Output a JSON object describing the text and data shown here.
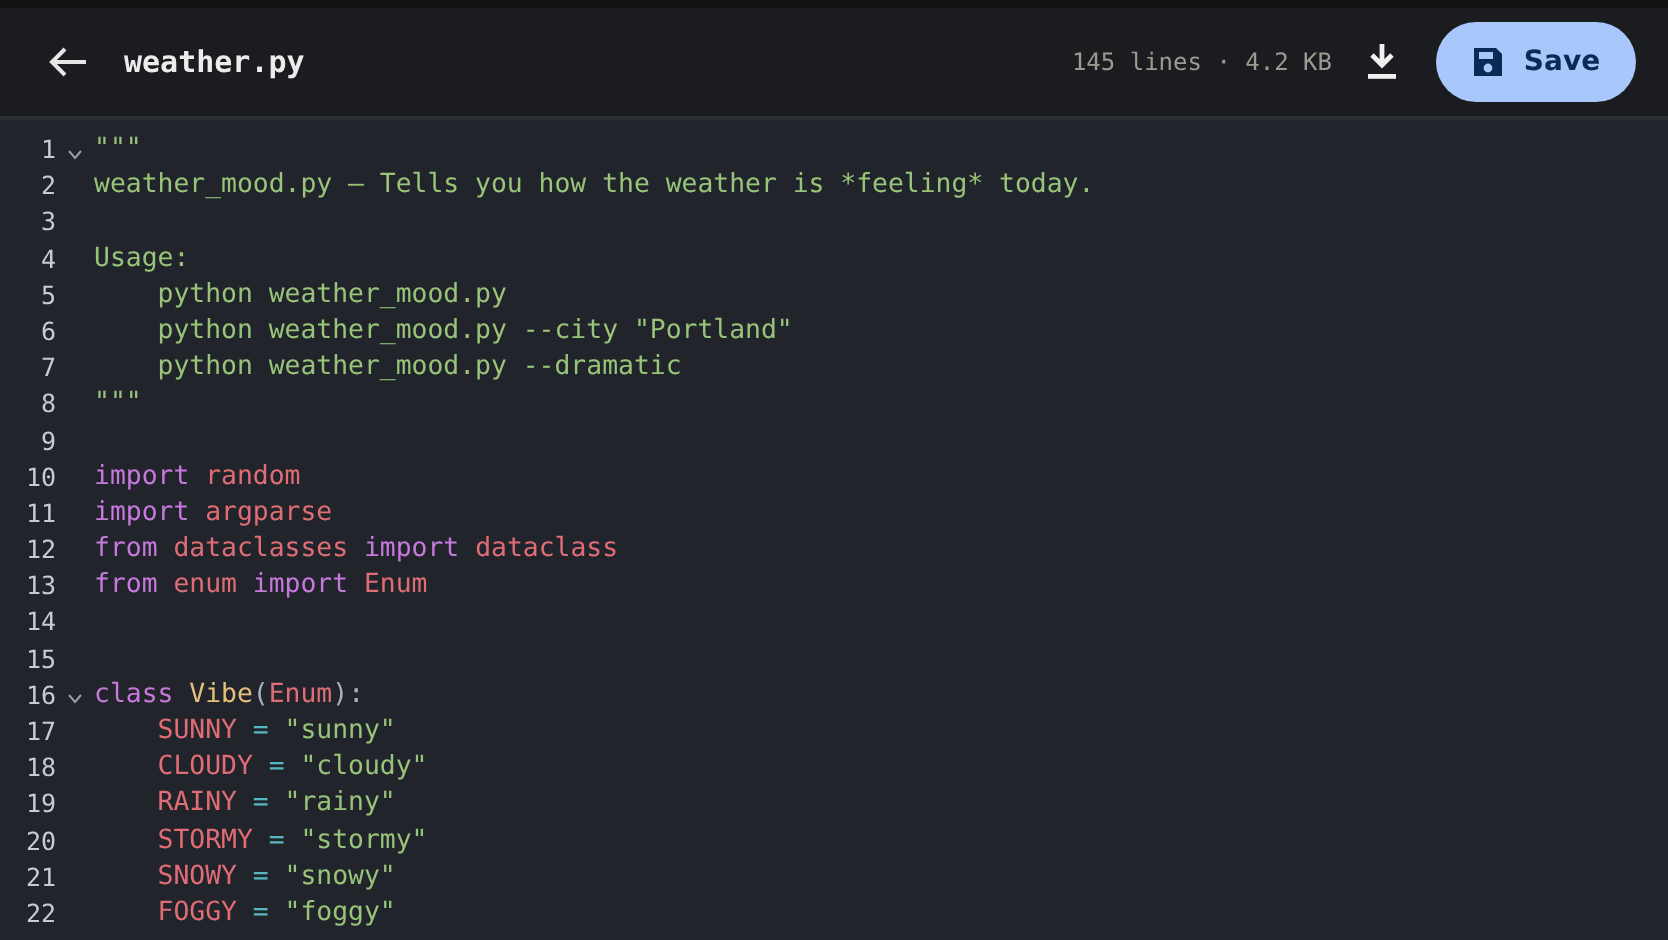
{
  "header": {
    "title": "weather.py",
    "meta": "145 lines · 4.2 KB",
    "save_button": "Save"
  },
  "editor": {
    "lines": [
      {
        "number": "1",
        "foldable": true,
        "tokens": [
          {
            "kind": "doc",
            "text": "\"\"\""
          }
        ]
      },
      {
        "number": "2",
        "foldable": false,
        "tokens": [
          {
            "kind": "doc",
            "text": "weather_mood.py — Tells you how the weather is *feeling* today."
          }
        ]
      },
      {
        "number": "3",
        "foldable": false
      },
      {
        "number": "4",
        "foldable": false,
        "tokens": [
          {
            "kind": "doc",
            "text": "Usage:"
          }
        ]
      },
      {
        "number": "5",
        "foldable": false,
        "tokens": [
          {
            "kind": "doc",
            "text": "    python weather_mood.py"
          }
        ]
      },
      {
        "number": "6",
        "foldable": false,
        "tokens": [
          {
            "kind": "doc",
            "text": "    python weather_mood.py --city \"Portland\""
          }
        ]
      },
      {
        "number": "7",
        "foldable": false,
        "tokens": [
          {
            "kind": "doc",
            "text": "    python weather_mood.py --dramatic"
          }
        ]
      },
      {
        "number": "8",
        "foldable": false,
        "tokens": [
          {
            "kind": "doc",
            "text": "\"\"\""
          }
        ]
      },
      {
        "number": "9",
        "foldable": false
      },
      {
        "number": "10",
        "foldable": false,
        "tokens": [
          {
            "kind": "keyword",
            "text": "import "
          },
          {
            "kind": "name",
            "text": "random"
          }
        ]
      },
      {
        "number": "11",
        "foldable": false,
        "tokens": [
          {
            "kind": "keyword",
            "text": "import "
          },
          {
            "kind": "name",
            "text": "argparse"
          }
        ]
      },
      {
        "number": "12",
        "foldable": false,
        "tokens": [
          {
            "kind": "keyword",
            "text": "from "
          },
          {
            "kind": "name",
            "text": "dataclasses "
          },
          {
            "kind": "keyword",
            "text": "import "
          },
          {
            "kind": "name",
            "text": "dataclass"
          }
        ]
      },
      {
        "number": "13",
        "foldable": false,
        "tokens": [
          {
            "kind": "keyword",
            "text": "from "
          },
          {
            "kind": "name",
            "text": "enum "
          },
          {
            "kind": "keyword",
            "text": "import "
          },
          {
            "kind": "name",
            "text": "Enum"
          }
        ]
      },
      {
        "number": "14",
        "foldable": false
      },
      {
        "number": "15",
        "foldable": false
      },
      {
        "number": "16",
        "foldable": true,
        "tokens": [
          {
            "kind": "keyword",
            "text": "class "
          },
          {
            "kind": "class",
            "text": "Vibe"
          },
          {
            "kind": "plain",
            "text": "("
          },
          {
            "kind": "name",
            "text": "Enum"
          },
          {
            "kind": "plain",
            "text": "):"
          }
        ]
      },
      {
        "number": "17",
        "foldable": false,
        "tokens": [
          {
            "kind": "name",
            "text": "    SUNNY "
          },
          {
            "kind": "op",
            "text": "= "
          },
          {
            "kind": "string",
            "text": "\"sunny\""
          }
        ]
      },
      {
        "number": "18",
        "foldable": false,
        "tokens": [
          {
            "kind": "name",
            "text": "    CLOUDY "
          },
          {
            "kind": "op",
            "text": "= "
          },
          {
            "kind": "string",
            "text": "\"cloudy\""
          }
        ]
      },
      {
        "number": "19",
        "foldable": false,
        "tokens": [
          {
            "kind": "name",
            "text": "    RAINY "
          },
          {
            "kind": "op",
            "text": "= "
          },
          {
            "kind": "string",
            "text": "\"rainy\""
          }
        ]
      },
      {
        "number": "20",
        "foldable": false,
        "tokens": [
          {
            "kind": "name",
            "text": "    STORMY "
          },
          {
            "kind": "op",
            "text": "= "
          },
          {
            "kind": "string",
            "text": "\"stormy\""
          }
        ]
      },
      {
        "number": "21",
        "foldable": false,
        "tokens": [
          {
            "kind": "name",
            "text": "    SNOWY "
          },
          {
            "kind": "op",
            "text": "= "
          },
          {
            "kind": "string",
            "text": "\"snowy\""
          }
        ]
      },
      {
        "number": "22",
        "foldable": false,
        "tokens": [
          {
            "kind": "name",
            "text": "    FOGGY "
          },
          {
            "kind": "op",
            "text": "= "
          },
          {
            "kind": "string",
            "text": "\"foggy\""
          }
        ]
      }
    ]
  }
}
